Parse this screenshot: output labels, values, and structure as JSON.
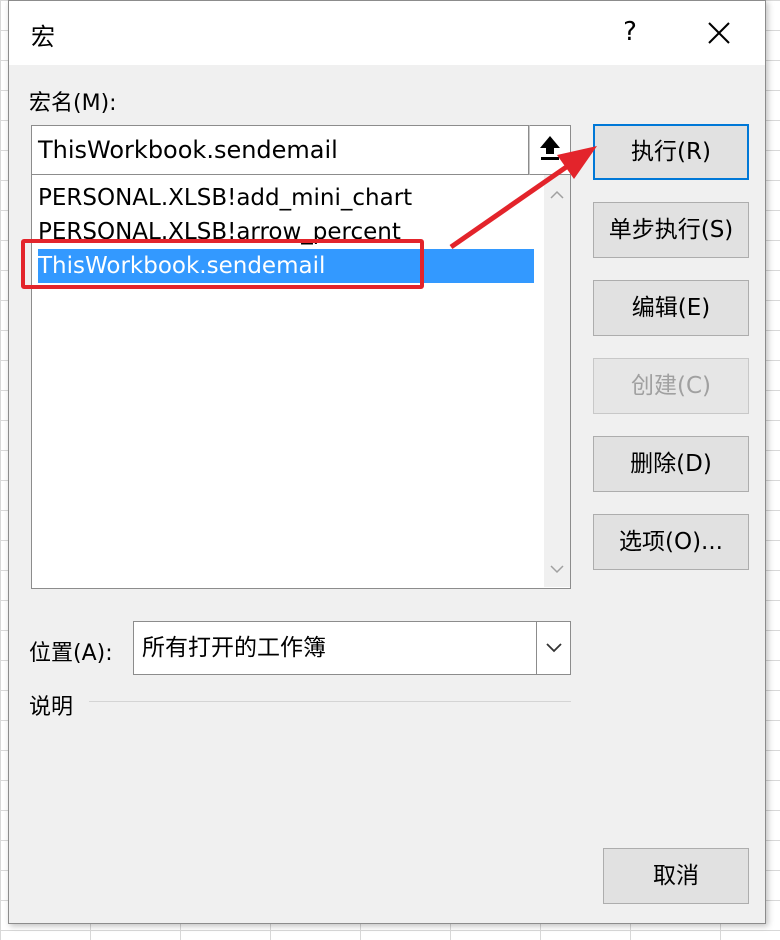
{
  "dialog": {
    "title": "宏",
    "help_label": "?",
    "macro_name_label": "宏名(M):",
    "macro_name_value": "ThisWorkbook.sendemail",
    "macros": [
      "PERSONAL.XLSB!add_mini_chart",
      "PERSONAL.XLSB!arrow_percent",
      "ThisWorkbook.sendemail"
    ],
    "selected_index": 2,
    "buttons": {
      "run": "执行(R)",
      "step_into": "单步执行(S)",
      "edit": "编辑(E)",
      "create": "创建(C)",
      "delete": "删除(D)",
      "options": "选项(O)...",
      "cancel": "取消"
    },
    "location_label": "位置(A):",
    "location_value": "所有打开的工作簿",
    "description_label": "说明"
  },
  "annotation": {
    "color": "#e3242b"
  },
  "colors": {
    "selection": "#3399ff",
    "default_button_border": "#0078d7"
  }
}
